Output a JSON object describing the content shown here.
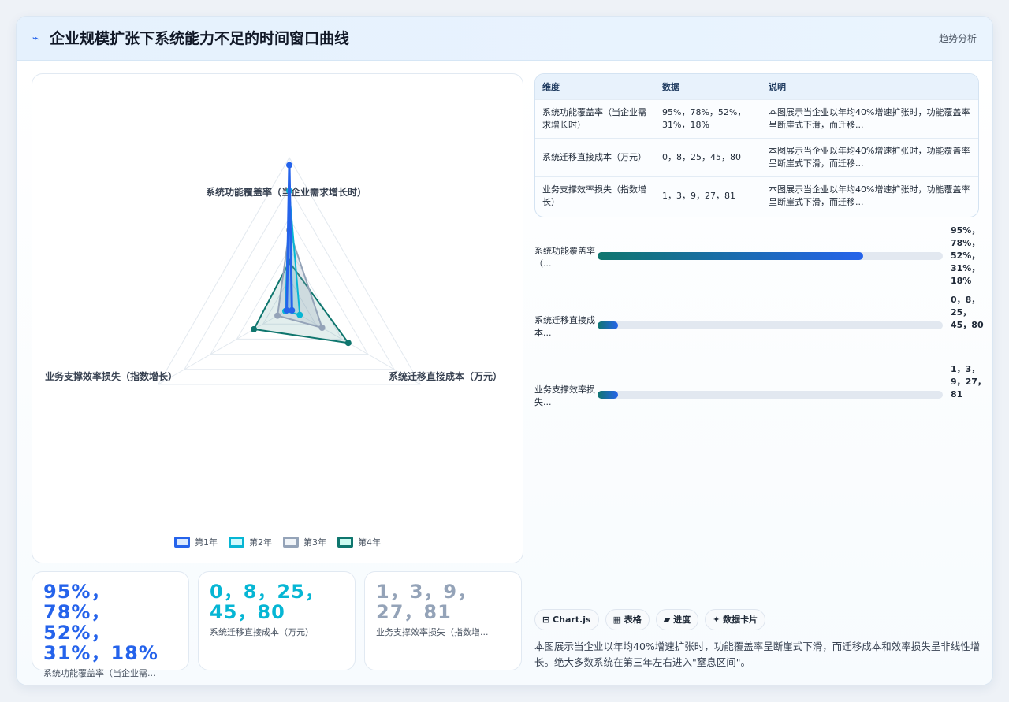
{
  "header": {
    "icon": "pulse-icon",
    "title": "企业规模扩张下系统能力不足的时间窗口曲线",
    "tag": "趋势分析"
  },
  "chart_data": {
    "type": "radar",
    "axes": [
      "系统功能覆盖率（当企业需求增长时）",
      "系统迁移直接成本（万元）",
      "业务支撑效率损失（指数增长）"
    ],
    "series": [
      {
        "name": "第1年",
        "values": [
          95,
          0,
          1
        ],
        "color": "#2563eb"
      },
      {
        "name": "第2年",
        "values": [
          78,
          8,
          3
        ],
        "color": "#06b6d4"
      },
      {
        "name": "第3年",
        "values": [
          52,
          25,
          9
        ],
        "color": "#94a3b8"
      },
      {
        "name": "第4年",
        "values": [
          31,
          45,
          27
        ],
        "color": "#0f766e"
      }
    ],
    "rmax": 100,
    "grid": true,
    "legend": "bottom"
  },
  "kpis": [
    {
      "value": "95%，78%，52%，31%，18%",
      "label": "系统功能覆盖率（当企业需...",
      "color": "#2563eb"
    },
    {
      "value": "0，8，25，45，80",
      "label": "系统迁移直接成本（万元）",
      "color": "#06b6d4"
    },
    {
      "value": "1，3，9，27，81",
      "label": "业务支撑效率损失（指数增...",
      "color": "#94a3b8"
    }
  ],
  "table": {
    "headers": [
      "维度",
      "数据",
      "说明"
    ],
    "rows": [
      [
        "系统功能覆盖率（当企业需求增长时）",
        "95%，78%，52%，31%，18%",
        "本图展示当企业以年均40%增速扩张时，功能覆盖率呈断崖式下滑，而迁移..."
      ],
      [
        "系统迁移直接成本（万元）",
        "0，8，25，45，80",
        "本图展示当企业以年均40%增速扩张时，功能覆盖率呈断崖式下滑，而迁移..."
      ],
      [
        "业务支撑效率损失（指数增长）",
        "1，3，9，27，81",
        "本图展示当企业以年均40%增速扩张时，功能覆盖率呈断崖式下滑，而迁移..."
      ]
    ]
  },
  "progress": [
    {
      "label": "系统功能覆盖率（...",
      "value": "95%，78%，52%，31%，18%",
      "fill": 0.77
    },
    {
      "label": "系统迁移直接成本...",
      "value": "0，8，25，45，80",
      "fill": 0.06
    },
    {
      "label": "业务支撑效率损失...",
      "value": "1，3，9，27，81",
      "fill": 0.06
    }
  ],
  "chips": [
    "⊟ Chart.js",
    "▦ 表格",
    "▰ 进度",
    "✦ 数据卡片"
  ],
  "summary": "本图展示当企业以年均40%增速扩张时，功能覆盖率呈断崖式下滑，而迁移成本和效率损失呈非线性增长。绝大多数系统在第三年左右进入\"窒息区间\"。"
}
